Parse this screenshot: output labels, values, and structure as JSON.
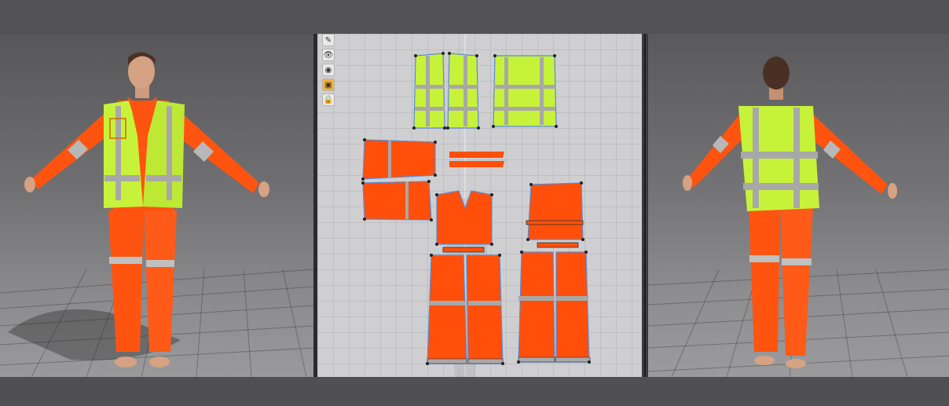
{
  "app": {
    "colors": {
      "background": "#4d4d4f",
      "pattern_window": "#cfcfd1",
      "hi_vis_vest": "#c7f23a",
      "coverall_orange": "#ff4f0a",
      "reflective_tape": "#b9b9b9",
      "seam_line": "#4a8ed6"
    }
  },
  "toolbar": {
    "tools": [
      {
        "icon": "pen-icon"
      },
      {
        "icon": "eye-shirt-icon"
      },
      {
        "icon": "eye-vest-icon"
      },
      {
        "icon": "texture-icon"
      },
      {
        "icon": "lock-icon"
      }
    ]
  },
  "views": {
    "left": "3d-avatar-front",
    "center": "2d-pattern-editor",
    "right": "3d-avatar-back"
  }
}
